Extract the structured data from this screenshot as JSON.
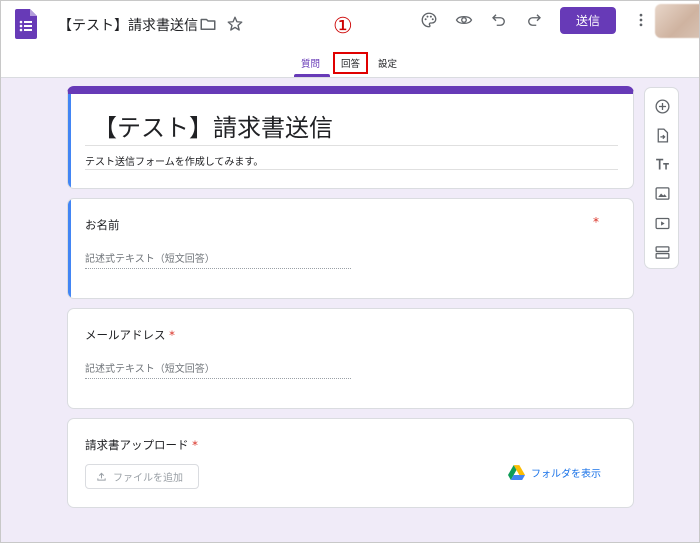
{
  "header": {
    "title": "【テスト】請求書送信",
    "send_label": "送信",
    "tabs": [
      {
        "label": "質問"
      },
      {
        "label": "回答"
      },
      {
        "label": "設定"
      }
    ],
    "step_marker": "①"
  },
  "form": {
    "title": "【テスト】請求書送信",
    "description": "テスト送信フォームを作成してみます。"
  },
  "questions": [
    {
      "label": "お名前",
      "required": "*",
      "placeholder": "記述式テキスト（短文回答）"
    },
    {
      "label": "メールアドレス",
      "required": "*",
      "placeholder": "記述式テキスト（短文回答）"
    },
    {
      "label": "請求書アップロード",
      "required": "*",
      "file_button": "ファイルを追加",
      "folder_link": "フォルダを表示"
    }
  ],
  "colors": {
    "accent": "#673ab7",
    "active_bar": "#4285f4",
    "background": "#f0ebf8",
    "highlight": "#e00000",
    "required": "#d93025",
    "link": "#1a73e8"
  },
  "icons": {
    "header": [
      "forms-logo-icon",
      "folder-icon",
      "star-icon",
      "palette-icon",
      "preview-eye-icon",
      "undo-icon",
      "redo-icon",
      "more-vert-icon"
    ],
    "toolbar": [
      "add-question-icon",
      "import-questions-icon",
      "add-title-icon",
      "add-image-icon",
      "add-video-icon",
      "add-section-icon"
    ]
  }
}
